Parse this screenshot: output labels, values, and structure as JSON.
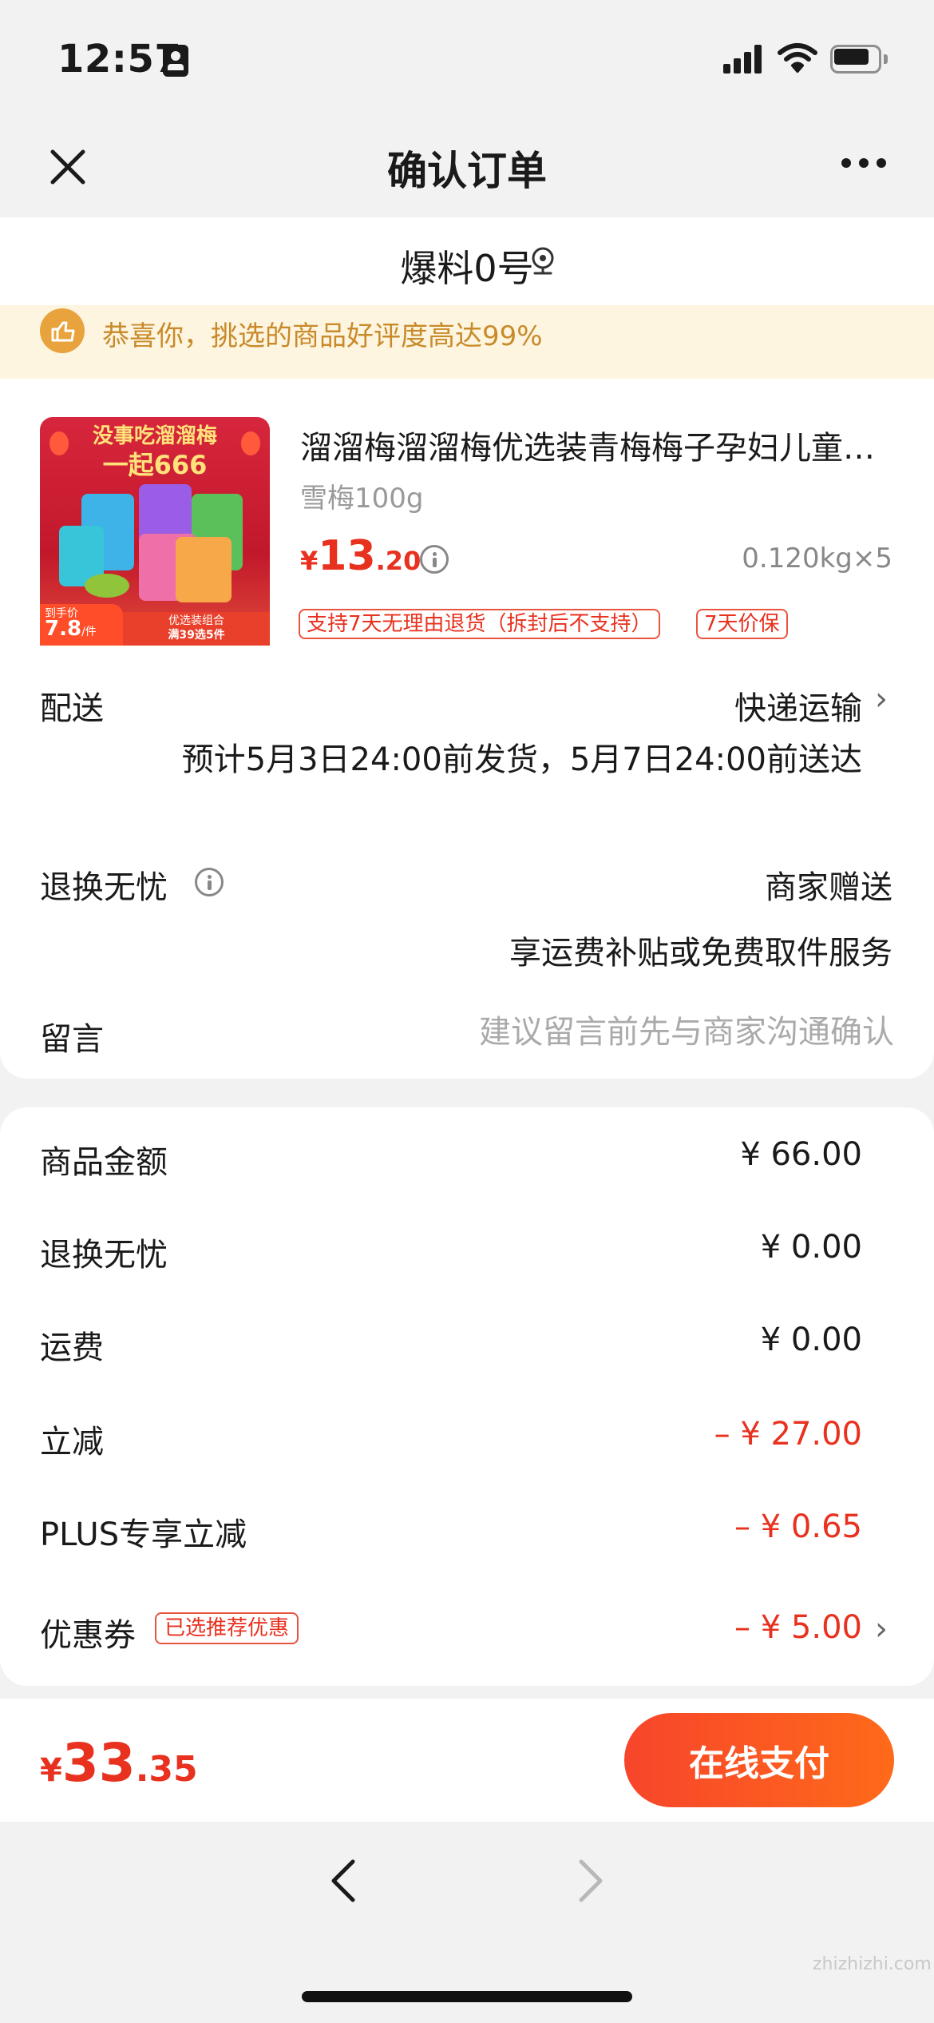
{
  "status_bar": {
    "time": "12:57",
    "battery_level": 0.8
  },
  "nav": {
    "title": "确认订单"
  },
  "address": {
    "name": "爆料0号"
  },
  "banner": {
    "text": "恭喜你，挑选的商品好评度高达99%",
    "icon": "thumbs-up-icon"
  },
  "product": {
    "image": {
      "headline_line1": "没事吃溜溜梅",
      "headline_line2": "一起666",
      "price_tag_label": "到手价",
      "price_tag_value": "7.8",
      "price_tag_unit": "/件",
      "combo_line1": "优选装组合",
      "combo_line2": "满39选5件"
    },
    "title": "溜溜梅溜溜梅优选装青梅梅子孕妇儿童解馋零食蜜饯果干",
    "spec": "雪梅100g",
    "price_currency": "¥",
    "price_int": "13",
    "price_dec": ".20",
    "weight_qty": "0.120kg×5",
    "tags": [
      "支持7天无理由退货（拆封后不支持）",
      "7天价保"
    ]
  },
  "delivery": {
    "label": "配送",
    "method": "快递运输",
    "estimate": "预计5月3日24:00前发货，5月7日24:00前送达"
  },
  "return_service": {
    "label": "退换无忧",
    "value": "商家赠送",
    "desc": "享运费补贴或免费取件服务"
  },
  "message": {
    "label": "留言",
    "placeholder": "建议留言前先与商家沟通确认"
  },
  "summary": [
    {
      "label": "商品金额",
      "value": "¥ 66.00"
    },
    {
      "label": "退换无忧",
      "value": "¥ 0.00"
    },
    {
      "label": "运费",
      "value": "¥ 0.00"
    },
    {
      "label": "立减",
      "value": "– ¥ 27.00"
    },
    {
      "label": "PLUS专享立减",
      "value": "– ¥ 0.65"
    },
    {
      "label": "优惠券",
      "value": "– ¥ 5.00",
      "tag": "已选推荐优惠"
    }
  ],
  "pay_bar": {
    "total_currency": "¥",
    "total_int": "33",
    "total_dec": ".35",
    "button_label": "在线支付"
  },
  "watermark": "zhizhizhi.com",
  "colors": {
    "accent_red": "#e8311f",
    "pay_gradient_start": "#f7452b",
    "pay_gradient_end": "#ff6a1a",
    "banner_bg": "#fdf5df",
    "banner_text": "#c98a2a"
  }
}
